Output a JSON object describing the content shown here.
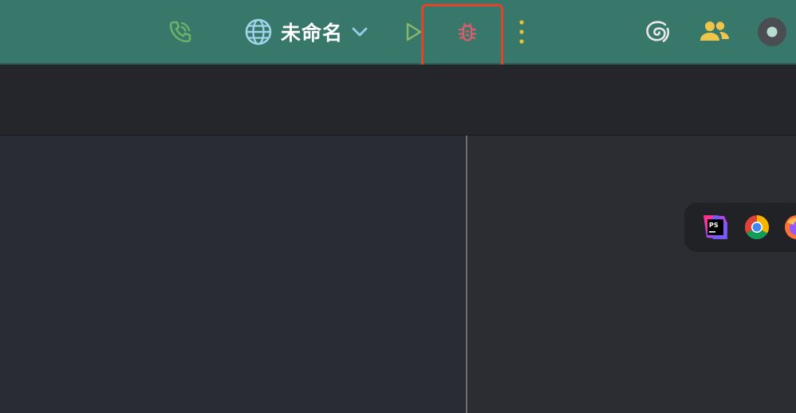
{
  "toolbar": {
    "background": "#38786a",
    "project_name": "未命名",
    "icons": {
      "call": "phone-call-icon",
      "globe": "globe-icon",
      "chevron": "chevron-down-icon",
      "run": "run-icon",
      "debug": "debug-icon",
      "more": "more-vertical-icon",
      "ai": "ai-swirl-icon",
      "users": "users-icon",
      "status": "status-dot-icon"
    },
    "colors": {
      "call": "#66b36b",
      "globe": "#9fd3e8",
      "chevron": "#8fd0ea",
      "run": "#8ab86a",
      "debug": "#e05b6e",
      "more": "#e3c23a",
      "users": "#f0c64a"
    }
  },
  "highlight": {
    "target": "debug-button",
    "color": "#e6422b"
  },
  "browser_popup": {
    "items": [
      {
        "name": "phpstorm",
        "icon": "phpstorm-icon",
        "label": "PS"
      },
      {
        "name": "chrome",
        "icon": "chrome-icon"
      },
      {
        "name": "firefox",
        "icon": "firefox-icon"
      }
    ]
  }
}
